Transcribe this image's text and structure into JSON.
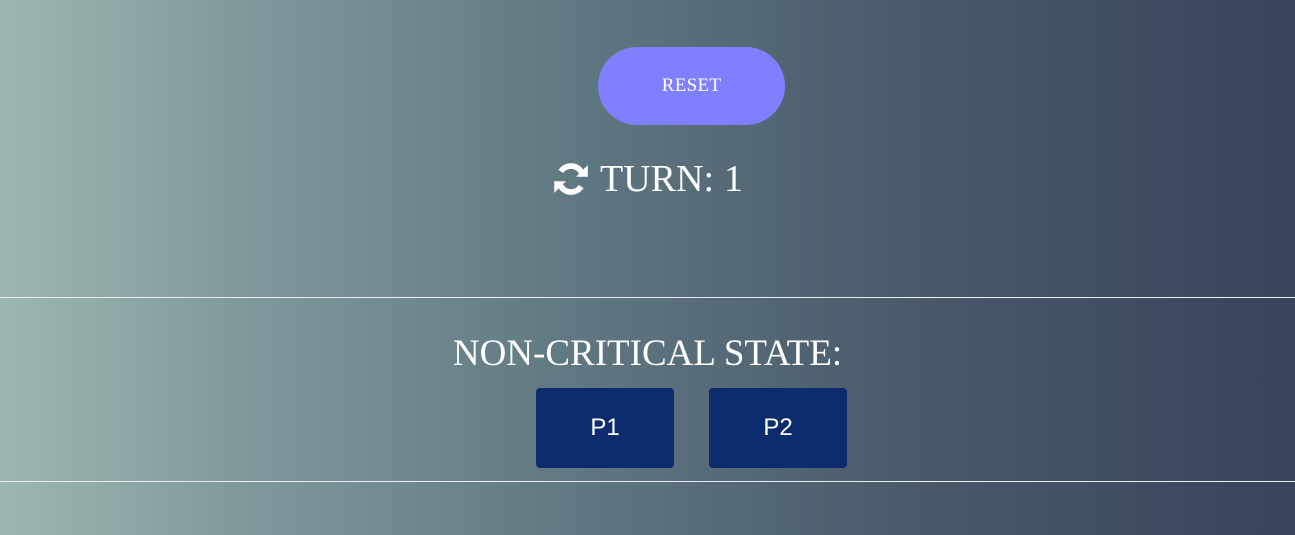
{
  "controls": {
    "reset_label": "RESET"
  },
  "turn": {
    "icon": "sync-icon",
    "label": "TURN:",
    "value": "1"
  },
  "state": {
    "title": "NON-CRITICAL STATE:",
    "players": [
      {
        "label": "P1"
      },
      {
        "label": "P2"
      }
    ]
  },
  "colors": {
    "reset_button": "#7f7fff",
    "player_button": "#0c2c6e",
    "text": "#ffffff",
    "gradient_start": "#9db6b0",
    "gradient_end": "#38435c"
  }
}
